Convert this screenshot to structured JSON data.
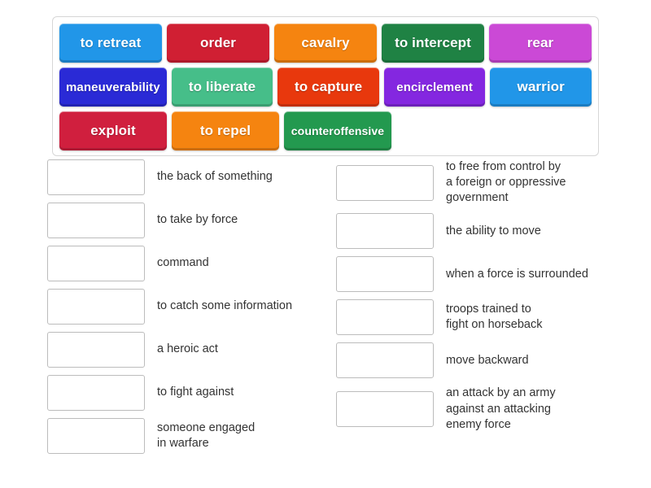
{
  "word_bank": {
    "rows": [
      [
        {
          "label": "to retreat",
          "color": "#2196e8"
        },
        {
          "label": "order",
          "color": "#d01f33"
        },
        {
          "label": "cavalry",
          "color": "#f58410"
        },
        {
          "label": "to intercept",
          "color": "#1f8244"
        },
        {
          "label": "rear",
          "color": "#cb49d6"
        }
      ],
      [
        {
          "label": "maneuverability",
          "color": "#2a2ad6"
        },
        {
          "label": "to liberate",
          "color": "#46be89"
        },
        {
          "label": "to capture",
          "color": "#e8380d"
        },
        {
          "label": "encirclement",
          "color": "#8427e0"
        },
        {
          "label": "warrior",
          "color": "#2196e8"
        }
      ],
      [
        {
          "label": "exploit",
          "color": "#d01f3e"
        },
        {
          "label": "to repel",
          "color": "#f58410"
        },
        {
          "label": "counteroffensive",
          "color": "#23994f"
        }
      ]
    ]
  },
  "answers": {
    "left_column": [
      {
        "definition": "the back of something"
      },
      {
        "definition": "to take by force"
      },
      {
        "definition": "command"
      },
      {
        "definition": "to catch some information"
      },
      {
        "definition": "a heroic act"
      },
      {
        "definition": "to fight against"
      },
      {
        "definition": "someone engaged\nin warfare"
      }
    ],
    "right_column": [
      {
        "definition": "to free from control by\na foreign or oppressive\ngovernment"
      },
      {
        "definition": "the ability to move"
      },
      {
        "definition": "when a force is surrounded"
      },
      {
        "definition": "troops trained to\nfight on horseback"
      },
      {
        "definition": "move backward"
      },
      {
        "definition": "an attack by an army\nagainst an attacking\nenemy force"
      }
    ]
  }
}
